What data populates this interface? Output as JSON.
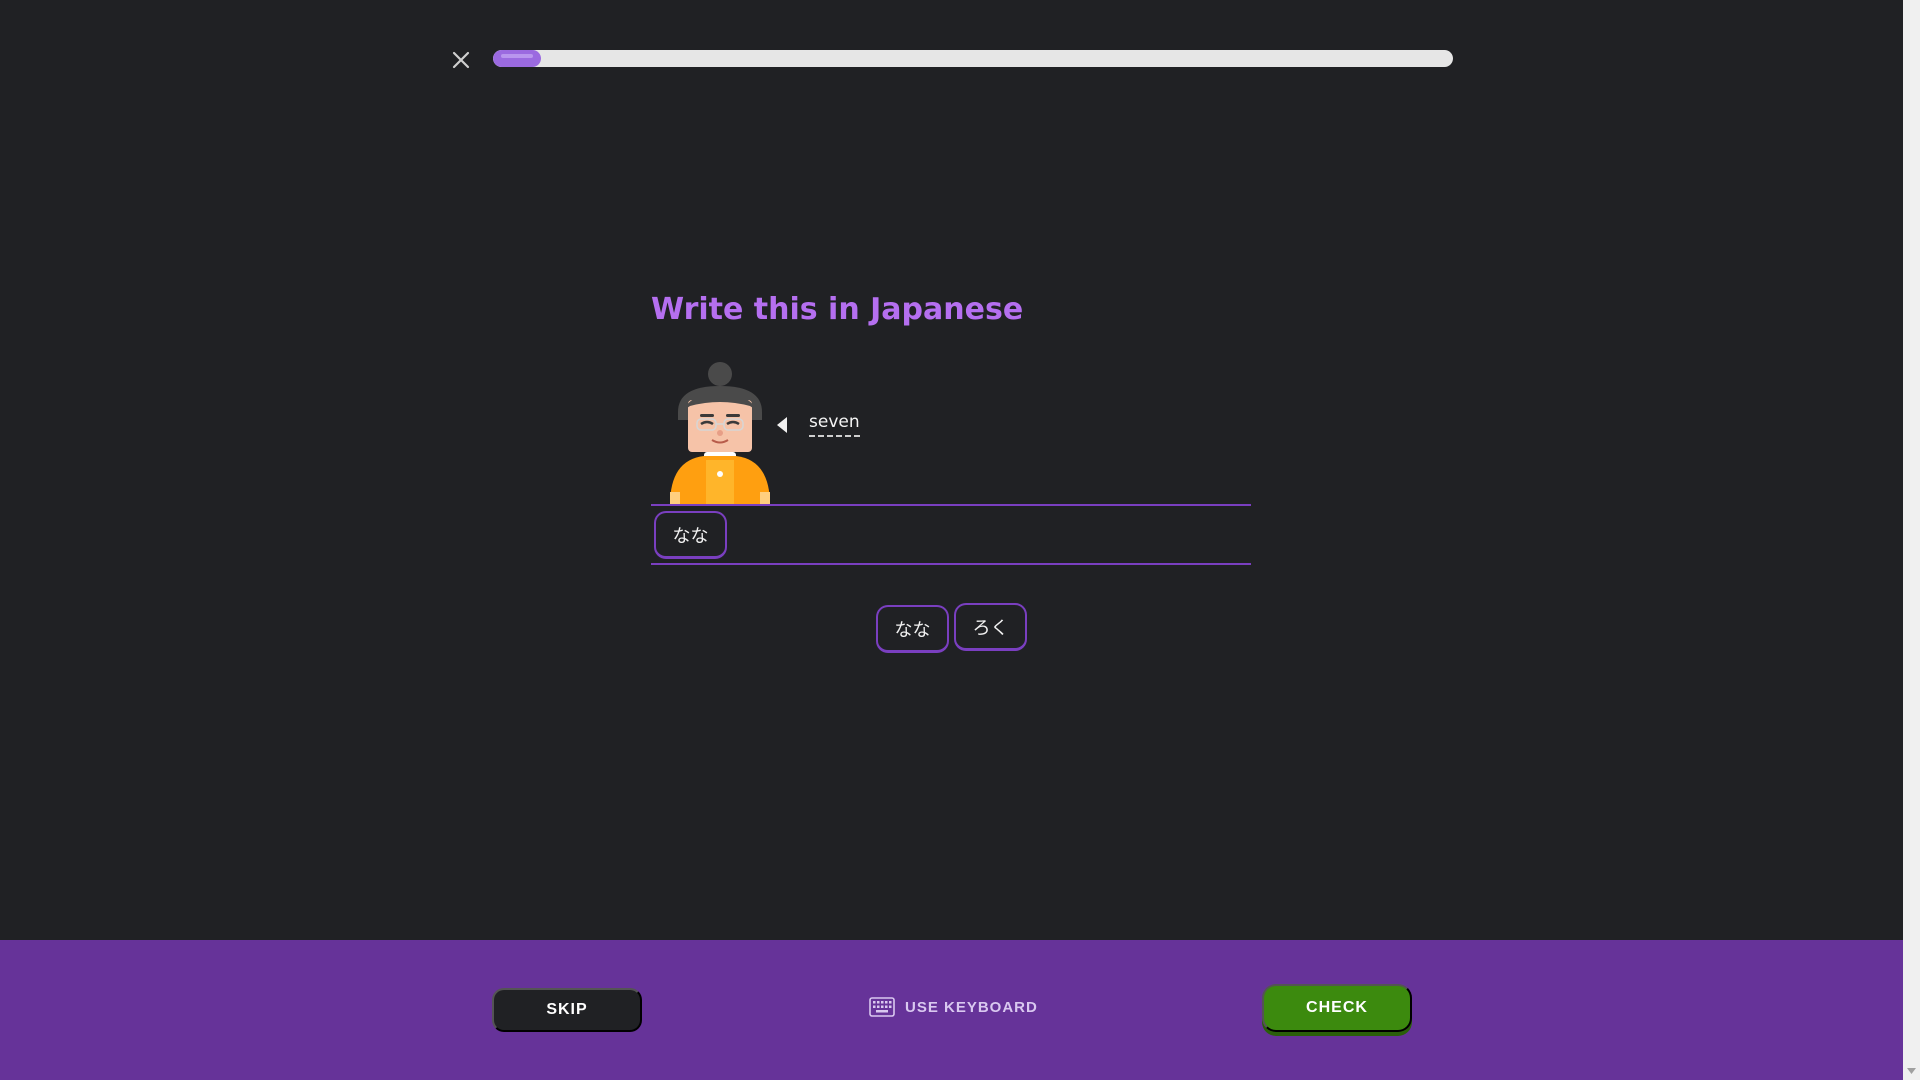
{
  "header": {
    "close_icon": "close-icon",
    "progress_percent": 5
  },
  "challenge": {
    "title": "Write this in Japanese",
    "prompt_word": "seven",
    "speaker_icon": "speaker-icon"
  },
  "answer": {
    "selected_tiles": [
      "なな"
    ]
  },
  "word_bank": {
    "tiles": [
      "なな",
      "ろく"
    ]
  },
  "footer": {
    "skip_label": "SKIP",
    "keyboard_label": "USE KEYBOARD",
    "keyboard_icon": "keyboard-icon",
    "check_label": "CHECK"
  },
  "colors": {
    "background": "#202124",
    "accent_purple": "#b56ff0",
    "tile_border": "#7a3fc0",
    "footer": "#663399",
    "check_green": "#3c8a0e",
    "progress_fill": "#9b6ae0"
  }
}
